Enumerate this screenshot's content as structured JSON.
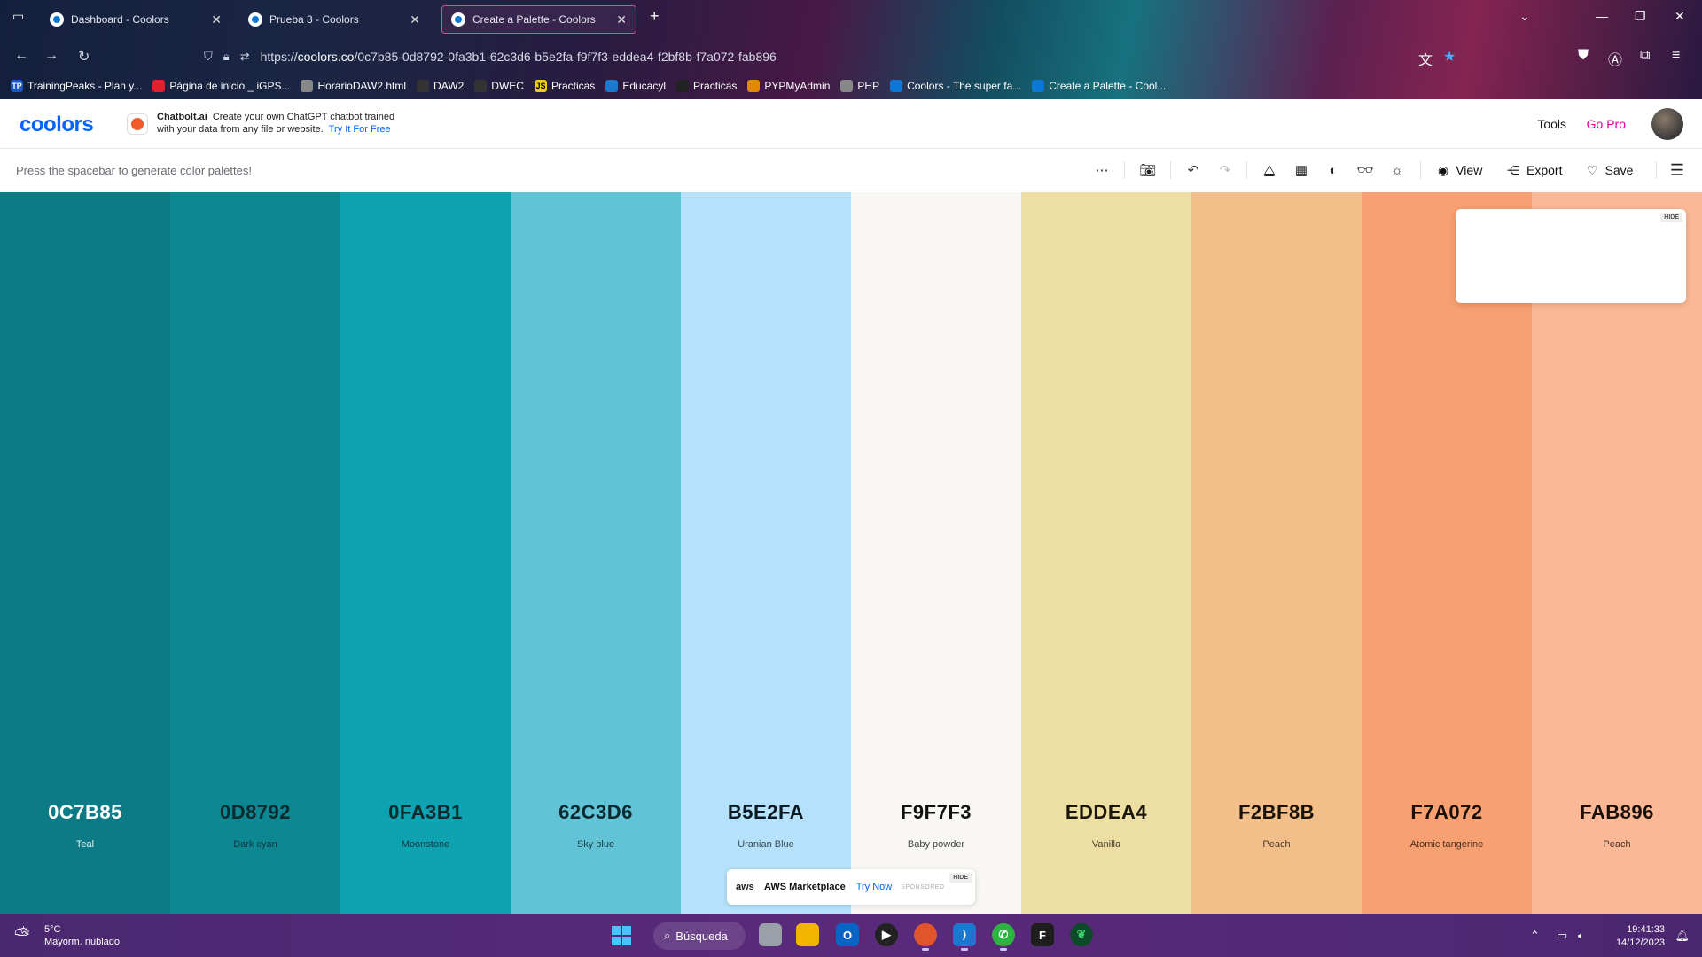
{
  "browser": {
    "tabs": [
      {
        "title": "Dashboard - Coolors",
        "active": false
      },
      {
        "title": "Prueba 3 - Coolors",
        "active": false
      },
      {
        "title": "Create a Palette - Coolors",
        "active": true
      }
    ],
    "url_prefix": "https://",
    "url_host": "coolors.co",
    "url_path": "/0c7b85-0d8792-0fa3b1-62c3d6-b5e2fa-f9f7f3-eddea4-f2bf8b-f7a072-fab896",
    "bookmarks": [
      {
        "label": "TrainingPeaks - Plan y...",
        "icon": "TP",
        "color": "#1a56c8"
      },
      {
        "label": "Página de inicio _ iGPS...",
        "icon": "",
        "color": "#e0202a"
      },
      {
        "label": "HorarioDAW2.html",
        "icon": "",
        "color": "#888888"
      },
      {
        "label": "DAW2",
        "icon": "",
        "color": "#333333"
      },
      {
        "label": "DWEC",
        "icon": "",
        "color": "#333333"
      },
      {
        "label": "Practicas",
        "icon": "JS",
        "color": "#f0d000"
      },
      {
        "label": "Educacyl",
        "icon": "",
        "color": "#1a7ad0"
      },
      {
        "label": "Practicas",
        "icon": "",
        "color": "#222222"
      },
      {
        "label": "PYPMyAdmin",
        "icon": "",
        "color": "#e08a00"
      },
      {
        "label": "PHP",
        "icon": "",
        "color": "#888888"
      },
      {
        "label": "Coolors - The super fa...",
        "icon": "",
        "color": "#0b78d8"
      },
      {
        "label": "Create a Palette - Cool...",
        "icon": "",
        "color": "#0b78d8"
      }
    ]
  },
  "header": {
    "logo": "coolors",
    "ad_brand": "Chatbolt.ai",
    "ad_line1": "Create your own ChatGPT chatbot trained",
    "ad_line2": "with your data from any file or website.",
    "ad_link": "Try It For Free",
    "tools": "Tools",
    "go_pro": "Go Pro"
  },
  "toolbar": {
    "hint": "Press the spacebar to generate color palettes!",
    "view": "View",
    "export": "Export",
    "save": "Save"
  },
  "palette": [
    {
      "hex": "0C7B85",
      "name": "Teal",
      "color": "#0C7B85",
      "text": "#ffffff",
      "sub": "#dff3f4"
    },
    {
      "hex": "0D8792",
      "name": "Dark cyan",
      "color": "#0D8792",
      "text": "#0a2a2e",
      "sub": "#0a3a3e"
    },
    {
      "hex": "0FA3B1",
      "name": "Moonstone",
      "color": "#0FA3B1",
      "text": "#0a2a2e",
      "sub": "#0a3a3e"
    },
    {
      "hex": "62C3D6",
      "name": "Sky blue",
      "color": "#62C3D6",
      "text": "#0a2a30",
      "sub": "#164048"
    },
    {
      "hex": "B5E2FA",
      "name": "Uranian Blue",
      "color": "#B5E2FA",
      "text": "#0a1a24",
      "sub": "#3a4a54"
    },
    {
      "hex": "F9F7F3",
      "name": "Baby powder",
      "color": "#F9F7F3",
      "text": "#111111",
      "sub": "#444444"
    },
    {
      "hex": "EDDEA4",
      "name": "Vanilla",
      "color": "#EDDEA4",
      "text": "#1a160a",
      "sub": "#4a4430"
    },
    {
      "hex": "F2BF8B",
      "name": "Peach",
      "color": "#F2BF8B",
      "text": "#1a1208",
      "sub": "#4a3a2a"
    },
    {
      "hex": "F7A072",
      "name": "Atomic tangerine",
      "color": "#F7A072",
      "text": "#1a1008",
      "sub": "#4a3022"
    },
    {
      "hex": "FAB896",
      "name": "Peach",
      "color": "#FAB896",
      "text": "#1a1008",
      "sub": "#4a3428"
    }
  ],
  "ads": {
    "hide": "HIDE",
    "aws_logo": "aws",
    "aws_title": "AWS Marketplace",
    "aws_try": "Try Now",
    "aws_sponsored": "SPONSORED"
  },
  "taskbar": {
    "temp": "5°C",
    "weather": "Mayorm. nublado",
    "search": "Búsqueda",
    "time": "19:41:33",
    "date": "14/12/2023"
  }
}
